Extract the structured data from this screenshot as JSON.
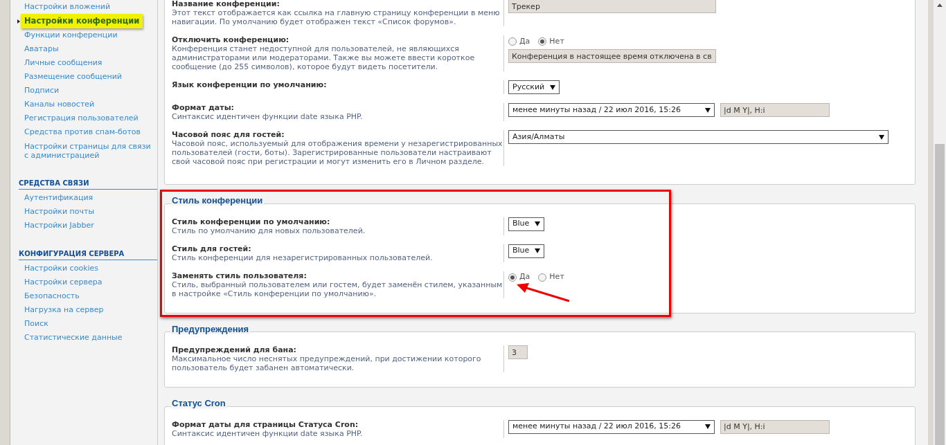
{
  "sidebar": {
    "sections": [
      {
        "items": [
          {
            "label": "Настройки вложений",
            "selected": false
          },
          {
            "label": "Настройки конференции",
            "selected": true
          },
          {
            "label": "Функции конференции",
            "selected": false
          },
          {
            "label": "Аватары",
            "selected": false
          },
          {
            "label": "Личные сообщения",
            "selected": false
          },
          {
            "label": "Размещение сообщений",
            "selected": false
          },
          {
            "label": "Подписи",
            "selected": false
          },
          {
            "label": "Каналы новостей",
            "selected": false
          },
          {
            "label": "Регистрация пользователей",
            "selected": false
          },
          {
            "label": "Средства против спам-ботов",
            "selected": false
          },
          {
            "label": "Настройки страницы для связи с администрацией",
            "selected": false
          }
        ]
      },
      {
        "heading": "СРЕДСТВА СВЯЗИ",
        "items": [
          {
            "label": "Аутентификация",
            "selected": false
          },
          {
            "label": "Настройки почты",
            "selected": false
          },
          {
            "label": "Настройки Jabber",
            "selected": false
          }
        ]
      },
      {
        "heading": "КОНФИГУРАЦИЯ СЕРВЕРА",
        "items": [
          {
            "label": "Настройки cookies",
            "selected": false
          },
          {
            "label": "Настройки сервера",
            "selected": false
          },
          {
            "label": "Безопасность",
            "selected": false
          },
          {
            "label": "Нагрузка на сервер",
            "selected": false
          },
          {
            "label": "Поиск",
            "selected": false
          },
          {
            "label": "Статистические данные",
            "selected": false
          }
        ]
      }
    ]
  },
  "panels": [
    {
      "annotated": false,
      "rows": [
        {
          "title": "Название конференции:",
          "description": "Этот текст отображается как ссылка на главную страницу конференции в меню навигации. По умолчанию будет отображен текст «Список форумов».",
          "control": {
            "kind": "text",
            "value": "Трекер"
          }
        },
        {
          "title": "Отключить конференцию:",
          "description": "Конференция станет недоступной для пользователей, не являющихся администраторами или модераторами. Также вы можете ввести короткое сообщение (до 255 символов), которое будут видеть посетители.",
          "control": {
            "kind": "radio_text",
            "options": [
              {
                "label": "Да",
                "selected": false
              },
              {
                "label": "Нет",
                "selected": true
              }
            ],
            "value": "Конференция в настоящее время отключена в св"
          }
        },
        {
          "title": "Язык конференции по умолчанию:",
          "control": {
            "kind": "select",
            "value": "Русский"
          }
        },
        {
          "title": "Формат даты:",
          "description": "Синтаксис идентичен функции date языка PHP.",
          "control": {
            "kind": "select_text",
            "value": "менее минуты назад / 22 июл 2016, 15:26",
            "text": "|d M Y|, H:i"
          }
        },
        {
          "title": "Часовой пояс для гостей:",
          "description": "Часовой пояс, используемый для отображения времени у незарегистрированных пользователей (гости, боты). Зарегистрированные пользователи настраивают свой часовой пояс при регистрации и могут изменить его в Личном разделе.",
          "control": {
            "kind": "select_wide",
            "value": "Азия/Алматы"
          }
        }
      ]
    },
    {
      "legend": "Стиль конференции",
      "annotated": true,
      "rows": [
        {
          "title": "Стиль конференции по умолчанию:",
          "description": "Стиль по умолчанию для новых пользователей.",
          "control": {
            "kind": "select",
            "value": "Blue"
          }
        },
        {
          "title": "Стиль для гостей:",
          "description": "Стиль конференции для незарегистрированных пользователей.",
          "control": {
            "kind": "select",
            "value": "Blue"
          }
        },
        {
          "title": "Заменять стиль пользователя:",
          "description": "Стиль, выбранный пользователем или гостем, будет заменён стилем, указанным в настройке «Стиль конференции по умолчанию».",
          "control": {
            "kind": "radio",
            "options": [
              {
                "label": "Да",
                "selected": true
              },
              {
                "label": "Нет",
                "selected": false
              }
            ]
          }
        }
      ]
    },
    {
      "legend": "Предупреждения",
      "annotated": false,
      "rows": [
        {
          "title": "Предупреждений для бана:",
          "description": "Максимальное число неснятых предупреждений, при достижении которого пользователь будет забанен автоматически.",
          "control": {
            "kind": "number",
            "value": "3"
          }
        }
      ]
    },
    {
      "legend": "Статус Cron",
      "annotated": false,
      "rows": [
        {
          "title": "Формат даты для страницы Статуса Cron:",
          "description": "Синтаксис идентичен функции date языка PHP.",
          "control": {
            "kind": "select_text",
            "value": "менее минуты назад / 22 июл 2016, 15:26",
            "text": "|d M Y|, H:i"
          }
        }
      ]
    }
  ]
}
